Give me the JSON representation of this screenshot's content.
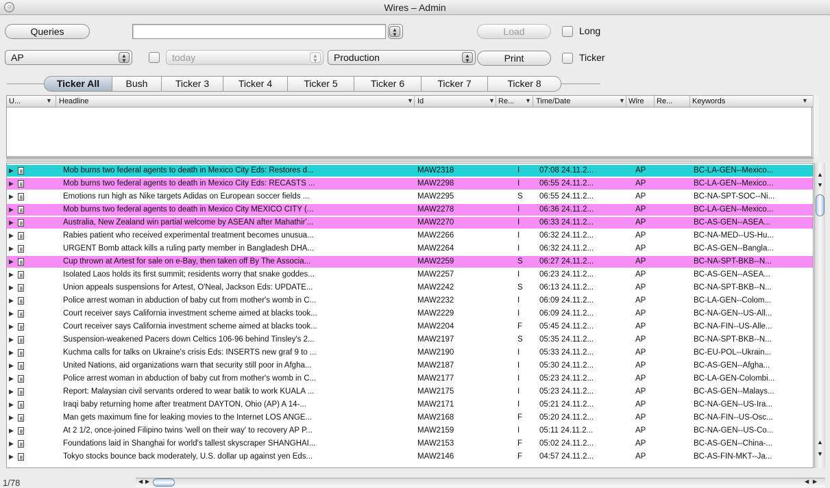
{
  "window": {
    "title": "Wires – Admin"
  },
  "toolbar": {
    "queries_label": "Queries",
    "query_value": "",
    "load_label": "Load",
    "long_label": "Long",
    "source_value": "AP",
    "date_placeholder": "today",
    "env_value": "Production",
    "print_label": "Print",
    "ticker_label": "Ticker"
  },
  "tabs": [
    {
      "label": "Ticker All",
      "selected": true
    },
    {
      "label": "Bush"
    },
    {
      "label": "Ticker 3"
    },
    {
      "label": "Ticker 4"
    },
    {
      "label": "Ticker 5"
    },
    {
      "label": "Ticker 6"
    },
    {
      "label": "Ticker 7"
    },
    {
      "label": "Ticker 8"
    }
  ],
  "columns": {
    "u": "U...",
    "headline": "Headline",
    "id": "Id",
    "re": "Re...",
    "time": "Time/Date",
    "wire": "Wire",
    "re2": "Re...",
    "keywords": "Keywords"
  },
  "colors": {
    "cyan_row": "#24d2d6",
    "pink_row": "#f78ef7"
  },
  "rows": [
    {
      "headline": "Mob burns two federal agents to death in Mexico City Eds: Restores d...",
      "id": "MAW2318",
      "re": "I",
      "time": "07:08 24.11.2...",
      "wire": "AP",
      "keywords": "BC-LA-GEN--Mexico...",
      "hl": "cyan"
    },
    {
      "headline": "Mob burns two federal agents to death in Mexico City Eds: RECASTS ...",
      "id": "MAW2298",
      "re": "I",
      "time": "06:55 24.11.2...",
      "wire": "AP",
      "keywords": "BC-LA-GEN--Mexico...",
      "hl": "pink"
    },
    {
      "headline": "Emotions run high as Nike targets Adidas on European soccer fields ...",
      "id": "MAW2295",
      "re": "S",
      "time": "06:55 24.11.2...",
      "wire": "AP",
      "keywords": "BC-NA-SPT-SOC--Ni...",
      "hl": ""
    },
    {
      "headline": "Mob burns two federal agents to death in Mexico City MEXICO CITY (...",
      "id": "MAW2278",
      "re": "I",
      "time": "06:36 24.11.2...",
      "wire": "AP",
      "keywords": "BC-LA-GEN--Mexico...",
      "hl": "pink"
    },
    {
      "headline": "Australia, New Zealand win partial welcome by ASEAN after Mahathir'...",
      "id": "MAW2270",
      "re": "I",
      "time": "06:33 24.11.2...",
      "wire": "AP",
      "keywords": "BC-AS-GEN--ASEA...",
      "hl": "pink"
    },
    {
      "headline": "Rabies patient who received experimental treatment becomes unusua...",
      "id": "MAW2266",
      "re": "I",
      "time": "06:32 24.11.2...",
      "wire": "AP",
      "keywords": "BC-NA-MED--US-Hu...",
      "hl": ""
    },
    {
      "headline": "URGENT Bomb attack kills a ruling party member in Bangladesh DHA...",
      "id": "MAW2264",
      "re": "I",
      "time": "06:32 24.11.2...",
      "wire": "AP",
      "keywords": "BC-AS-GEN--Bangla...",
      "hl": ""
    },
    {
      "headline": "Cup thrown at Artest for sale on e-Bay, then taken off By The Associa...",
      "id": "MAW2259",
      "re": "S",
      "time": "06:27 24.11.2...",
      "wire": "AP",
      "keywords": "BC-NA-SPT-BKB--N...",
      "hl": "pink"
    },
    {
      "headline": "Isolated Laos holds its first summit; residents worry that snake goddes...",
      "id": "MAW2257",
      "re": "I",
      "time": "06:23 24.11.2...",
      "wire": "AP",
      "keywords": "BC-AS-GEN--ASEA...",
      "hl": ""
    },
    {
      "headline": "Union appeals suspensions for Artest, O'Neal, Jackson Eds: UPDATE...",
      "id": "MAW2242",
      "re": "S",
      "time": "06:13 24.11.2...",
      "wire": "AP",
      "keywords": "BC-NA-SPT-BKB--N...",
      "hl": ""
    },
    {
      "headline": "Police arrest woman in abduction of baby cut from mother's womb in C...",
      "id": "MAW2232",
      "re": "I",
      "time": "06:09 24.11.2...",
      "wire": "AP",
      "keywords": "BC-LA-GEN--Colom...",
      "hl": ""
    },
    {
      "headline": "Court receiver says California investment scheme aimed at blacks took...",
      "id": "MAW2229",
      "re": "I",
      "time": "06:09 24.11.2...",
      "wire": "AP",
      "keywords": "BC-NA-GEN--US-All...",
      "hl": ""
    },
    {
      "headline": "Court receiver says California investment scheme aimed at blacks took...",
      "id": "MAW2204",
      "re": "F",
      "time": "05:45 24.11.2...",
      "wire": "AP",
      "keywords": "BC-NA-FIN--US-Alle...",
      "hl": ""
    },
    {
      "headline": "Suspension-weakened Pacers down Celtics 106-96 behind Tinsley's 2...",
      "id": "MAW2197",
      "re": "S",
      "time": "05:35 24.11.2...",
      "wire": "AP",
      "keywords": "BC-NA-SPT-BKB--N...",
      "hl": ""
    },
    {
      "headline": "Kuchma calls for talks on Ukraine's crisis Eds: INSERTS new graf 9 to ...",
      "id": "MAW2190",
      "re": "I",
      "time": "05:33 24.11.2...",
      "wire": "AP",
      "keywords": "BC-EU-POL--Ukrain...",
      "hl": ""
    },
    {
      "headline": "United Nations, aid organizations warn that security still poor in Afgha...",
      "id": "MAW2187",
      "re": "I",
      "time": "05:30 24.11.2...",
      "wire": "AP",
      "keywords": "BC-AS-GEN--Afgha...",
      "hl": ""
    },
    {
      "headline": "Police arrest woman in abduction of baby cut from mother's womb in C...",
      "id": "MAW2177",
      "re": "I",
      "time": "05:23 24.11.2...",
      "wire": "AP",
      "keywords": "BC-LA-GEN-Colombi...",
      "hl": ""
    },
    {
      "headline": "Report: Malaysian civil servants ordered to wear batik to work KUALA ...",
      "id": "MAW2175",
      "re": "I",
      "time": "05:23 24.11.2...",
      "wire": "AP",
      "keywords": "BC-AS-GEN--Malays...",
      "hl": ""
    },
    {
      "headline": "Iraqi baby returning home after treatment DAYTON, Ohio (AP)  A 14-...",
      "id": "MAW2171",
      "re": "I",
      "time": "05:21 24.11.2...",
      "wire": "AP",
      "keywords": "BC-NA-GEN--US-Ira...",
      "hl": ""
    },
    {
      "headline": "Man gets maximum fine for leaking movies to the Internet LOS ANGE...",
      "id": "MAW2168",
      "re": "F",
      "time": "05:20 24.11.2...",
      "wire": "AP",
      "keywords": "BC-NA-FIN--US-Osc...",
      "hl": ""
    },
    {
      "headline": "At 2 1/2, once-joined Filipino twins 'well on their way' to recovery AP P...",
      "id": "MAW2159",
      "re": "I",
      "time": "05:11 24.11.2...",
      "wire": "AP",
      "keywords": "BC-NA-GEN--US-Co...",
      "hl": ""
    },
    {
      "headline": "Foundations laid in Shanghai for world's tallest skyscraper SHANGHAI...",
      "id": "MAW2153",
      "re": "F",
      "time": "05:02 24.11.2...",
      "wire": "AP",
      "keywords": "BC-AS-GEN--China-...",
      "hl": ""
    },
    {
      "headline": "Tokyo stocks bounce back moderately, U.S. dollar up against yen Eds...",
      "id": "MAW2146",
      "re": "F",
      "time": "04:57 24.11.2...",
      "wire": "AP",
      "keywords": "BC-AS-FIN-MKT--Ja...",
      "hl": ""
    }
  ],
  "status": {
    "count": "1/78"
  }
}
